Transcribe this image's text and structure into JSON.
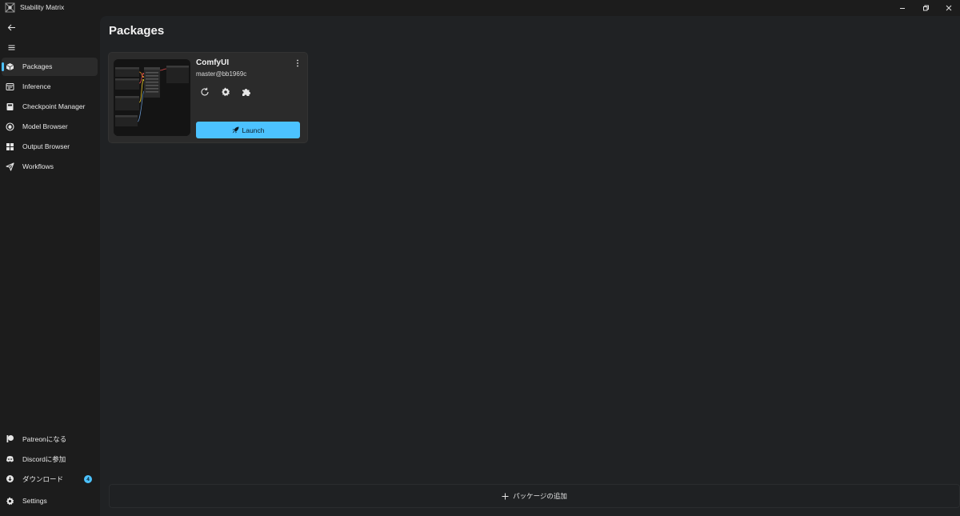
{
  "app": {
    "title": "Stability Matrix"
  },
  "nav": {
    "items": [
      {
        "label": "Packages",
        "icon": "package-icon",
        "selected": true
      },
      {
        "label": "Inference",
        "icon": "inference-icon"
      },
      {
        "label": "Checkpoint Manager",
        "icon": "checkpoint-icon"
      },
      {
        "label": "Model Browser",
        "icon": "model-browser-icon"
      },
      {
        "label": "Output Browser",
        "icon": "output-browser-icon"
      },
      {
        "label": "Workflows",
        "icon": "workflows-icon"
      }
    ],
    "footer": [
      {
        "label": "Patreonになる",
        "icon": "patreon-icon"
      },
      {
        "label": "Discordに参加",
        "icon": "discord-icon"
      },
      {
        "label": "ダウンロード",
        "icon": "download-icon",
        "badge": "4"
      },
      {
        "label": "Settings",
        "icon": "gear-icon"
      }
    ]
  },
  "main": {
    "title": "Packages",
    "package": {
      "name": "ComfyUI",
      "version": "master@bb1969c",
      "launch_label": "Launch"
    },
    "add_package_label": "パッケージの追加"
  },
  "colors": {
    "accent": "#4cc2ff",
    "background": "#1c1c1c",
    "content": "#202224",
    "card": "#2b2b2b"
  }
}
